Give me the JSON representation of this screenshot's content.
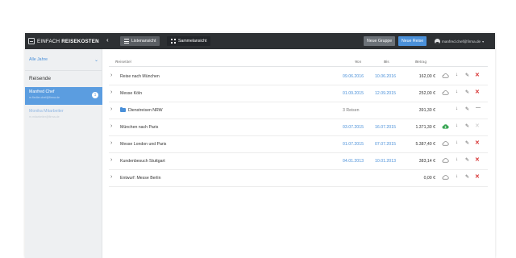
{
  "brand": {
    "prefix": "EINFACH",
    "name": "REISEKOSTEN"
  },
  "topbar": {
    "collapse_icon": "‹",
    "views": [
      {
        "label": "Listenansicht",
        "icon": "list-icon"
      },
      {
        "label": "Sammelansicht",
        "icon": "grid-icon"
      }
    ],
    "new_group_label": "Neue Gruppe",
    "new_trip_label": "Neue Reise",
    "user_email": "manfred.chef@firma.de",
    "caret": "▾"
  },
  "sidebar": {
    "year_filter": "Alle Jahre",
    "year_chevron": "⌄",
    "heading": "Reisende",
    "travelers": [
      {
        "name": "Manfred Chef",
        "email": "m.fiedler.chef@firma.de",
        "badge": "1"
      },
      {
        "name": "Monika Mitarbeiter",
        "email": "m.mitarbeiter@firma.de"
      }
    ]
  },
  "table": {
    "headers": {
      "title": "Reisetitel",
      "from": "Von",
      "to": "Bis",
      "amount": "Betrag"
    },
    "sort_icon": "▾",
    "rows": [
      {
        "chev": "›",
        "title": "Reise nach München",
        "from": "09.06.2016",
        "to": "10.06.2016",
        "amount": "162,00 €",
        "del": "✕",
        "cloud": "outline"
      },
      {
        "chev": "›",
        "title": "Messe Köln",
        "from": "01.09.2015",
        "to": "12.09.2015",
        "amount": "252,00 €",
        "del": "✕",
        "cloud": "outline"
      },
      {
        "chev": "›",
        "title": "Dienstreisen NRW",
        "from": "3 Reisen",
        "to": "",
        "amount": "391,30 €",
        "del": "",
        "more": "—",
        "group": true
      },
      {
        "chev": "›",
        "title": "München nach Paris",
        "from": "03.07.2015",
        "to": "16.07.2015",
        "amount": "1.371,30 €",
        "del": "✕",
        "cloud": "green",
        "del_muted": true
      },
      {
        "chev": "›",
        "title": "Messe London und Paris",
        "from": "01.07.2015",
        "to": "07.07.2015",
        "amount": "5.387,40 €",
        "del": "✕",
        "cloud": "outline"
      },
      {
        "chev": "›",
        "title": "Kundenbesuch Stuttgart",
        "from": "04.01.2013",
        "to": "10.01.2013",
        "amount": "383,14 €",
        "del": "✕",
        "cloud": "outline"
      },
      {
        "chev": "›",
        "title": "Entwurf: Messe Berlin",
        "from": "",
        "to": "",
        "amount": "0,00 €",
        "del": "✕",
        "cloud": "outline"
      }
    ],
    "download_icon": "↓",
    "edit_icon": "✎"
  },
  "colors": {
    "accent": "#4a90d9",
    "topbar": "#2d3033",
    "danger": "#d62f2f",
    "success": "#3aa655"
  }
}
